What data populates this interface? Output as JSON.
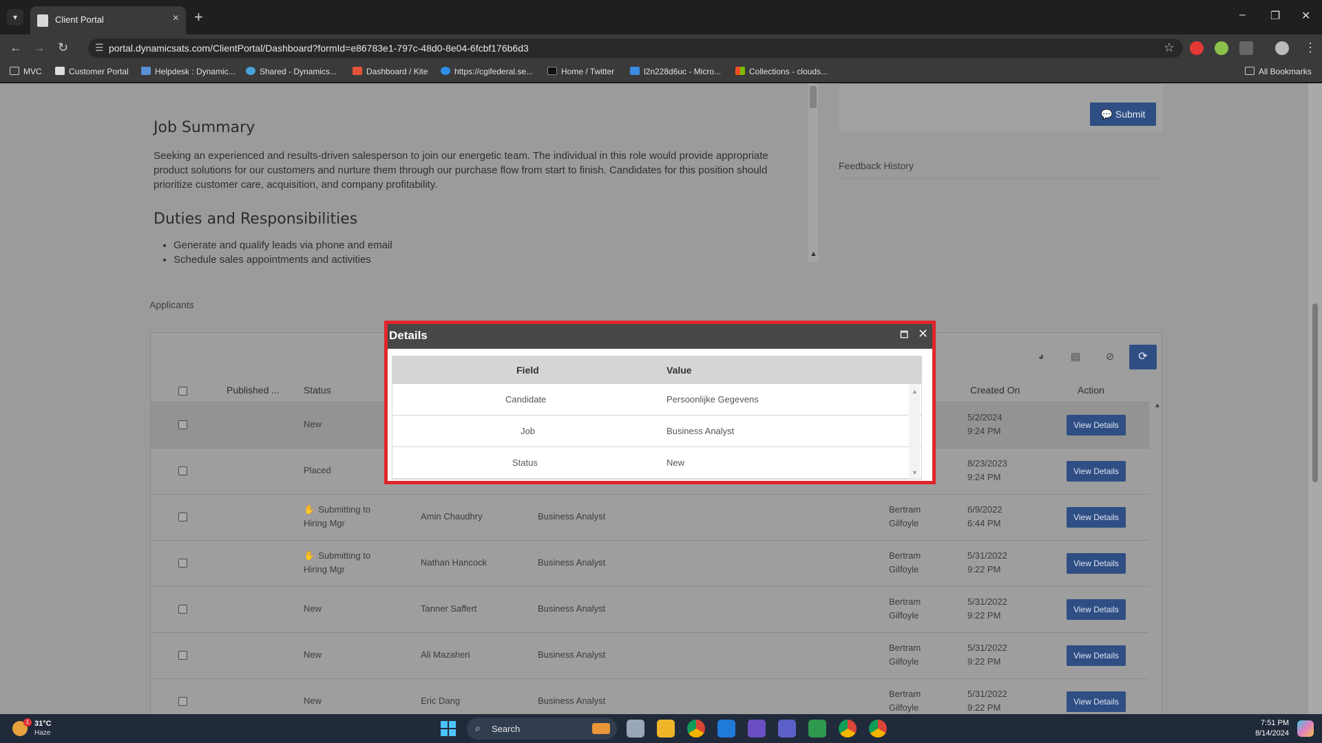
{
  "browser": {
    "tab_title": "Client Portal",
    "url": "portal.dynamicsats.com/ClientPortal/Dashboard?formId=e86783e1-797c-48d0-8e04-6fcbf176b6d3",
    "bookmarks": [
      "MVC",
      "Customer Portal",
      "Helpdesk : Dynamic...",
      "Shared - Dynamics...",
      "Dashboard / Kite",
      "https://cgifederal.se...",
      "Home / Twitter",
      "l2n228d6uc - Micro...",
      "Collections - clouds..."
    ],
    "all_bookmarks": "All Bookmarks"
  },
  "job": {
    "summary_heading": "Job Summary",
    "summary_text": "Seeking an experienced and results-driven salesperson to join our energetic team. The individual in this role would provide appropriate product solutions for our customers and nurture them through our purchase flow from start to finish. Candidates for this position should prioritize customer care, acquisition, and company profitability.",
    "duties_heading": "Duties and Responsibilities",
    "duties": [
      "Generate and qualify leads via phone and email",
      "Schedule sales appointments and activities"
    ]
  },
  "feedback": {
    "submit_label": "Submit",
    "history_label": "Feedback History"
  },
  "applicants": {
    "label": "Applicants",
    "headers": {
      "published": "Published ...",
      "status": "Status",
      "created_on": "Created On",
      "action": "Action"
    },
    "rows": [
      {
        "status": "New",
        "status2": "",
        "flag": false,
        "candidate": "",
        "job": "",
        "owner1": "",
        "owner2": "",
        "date": "5/2/2024",
        "time": "9:24 PM",
        "action": "View Details"
      },
      {
        "status": "Placed",
        "status2": "",
        "flag": false,
        "candidate": "",
        "job": "",
        "owner1": "",
        "owner2": "",
        "date": "8/23/2023",
        "time": "9:24 PM",
        "action": "View Details"
      },
      {
        "status": "Submitting to",
        "status2": "Hiring Mgr",
        "flag": true,
        "candidate": "Amin Chaudhry",
        "job": "Business Analyst",
        "owner1": "Bertram",
        "owner2": "Gilfoyle",
        "date": "6/9/2022",
        "time": "6:44 PM",
        "action": "View Details"
      },
      {
        "status": "Submitting to",
        "status2": "Hiring Mgr",
        "flag": true,
        "candidate": "Nathan Hancock",
        "job": "Business Analyst",
        "owner1": "Bertram",
        "owner2": "Gilfoyle",
        "date": "5/31/2022",
        "time": "9:22 PM",
        "action": "View Details"
      },
      {
        "status": "New",
        "status2": "",
        "flag": false,
        "candidate": "Tanner Saffert",
        "job": "Business Analyst",
        "owner1": "Bertram",
        "owner2": "Gilfoyle",
        "date": "5/31/2022",
        "time": "9:22 PM",
        "action": "View Details"
      },
      {
        "status": "New",
        "status2": "",
        "flag": false,
        "candidate": "Ali Mazaheri",
        "job": "Business Analyst",
        "owner1": "Bertram",
        "owner2": "Gilfoyle",
        "date": "5/31/2022",
        "time": "9:22 PM",
        "action": "View Details"
      },
      {
        "status": "New",
        "status2": "",
        "flag": false,
        "candidate": "Eric Dang",
        "job": "Business Analyst",
        "owner1": "Bertram",
        "owner2": "Gilfoyle",
        "date": "5/31/2022",
        "time": "9:22 PM",
        "action": "View Details"
      }
    ]
  },
  "modal": {
    "title": "Details",
    "headers": {
      "field": "Field",
      "value": "Value"
    },
    "rows": [
      {
        "field": "Candidate",
        "value": "Persoonlijke Gegevens"
      },
      {
        "field": "Job",
        "value": "Business Analyst"
      },
      {
        "field": "Status",
        "value": "New"
      }
    ]
  },
  "taskbar": {
    "weather_temp": "31°C",
    "weather_desc": "Haze",
    "weather_badge": "1",
    "search_label": "Search",
    "time": "7:51 PM",
    "date": "8/14/2024"
  },
  "colors": {
    "accent": "#2f4e84",
    "modal_border": "#e0262c",
    "page_overlay": "#9b9b9b"
  }
}
